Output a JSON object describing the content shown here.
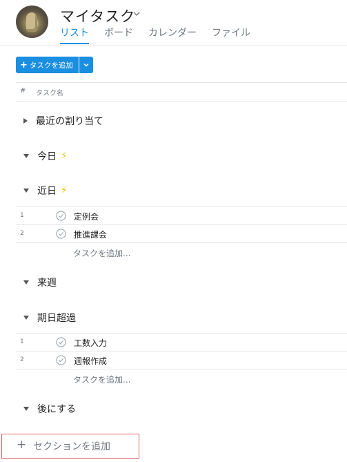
{
  "header": {
    "title": "マイタスク",
    "tabs": [
      "リスト",
      "ボード",
      "カレンダー",
      "ファイル"
    ],
    "active_tab": "リスト"
  },
  "toolbar": {
    "add_task_label": "タスクを追加"
  },
  "columns": {
    "index": "#",
    "task_name": "タスク名"
  },
  "sections": {
    "recent": {
      "label": "最近の割り当て",
      "expanded": false
    },
    "today": {
      "label": "今日",
      "expanded": true
    },
    "soon": {
      "label": "近日",
      "expanded": true,
      "tasks": [
        {
          "num": "1",
          "name": "定例会"
        },
        {
          "num": "2",
          "name": "推進課会"
        }
      ],
      "add_task": "タスクを追加..."
    },
    "next_week": {
      "label": "来週",
      "expanded": true
    },
    "overdue": {
      "label": "期日超過",
      "expanded": true,
      "tasks": [
        {
          "num": "1",
          "name": "工数入力"
        },
        {
          "num": "2",
          "name": "週報作成"
        }
      ],
      "add_task": "タスクを追加..."
    },
    "later": {
      "label": "後にする",
      "expanded": true
    }
  },
  "add_section": {
    "label": "セクションを追加"
  },
  "colors": {
    "accent": "#1a8ee0",
    "highlight_border": "#e15b5b",
    "bolt": "#f1c40f"
  }
}
